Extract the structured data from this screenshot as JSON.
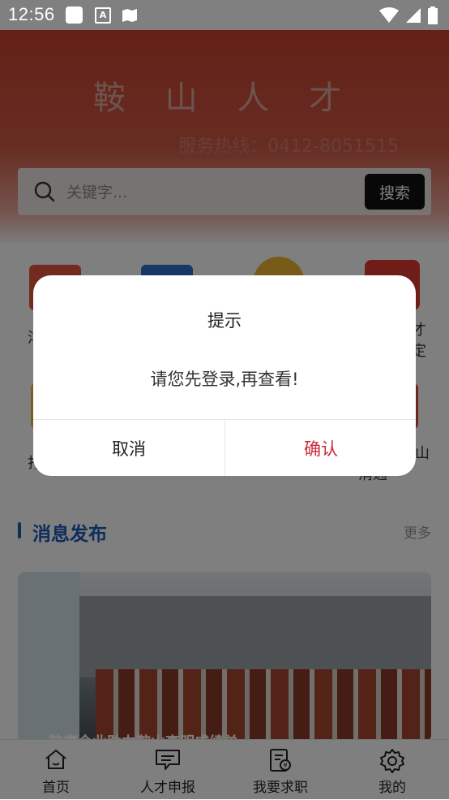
{
  "status_bar": {
    "time": "12:56",
    "icons": [
      "notification-square-icon",
      "a-badge-icon",
      "map-icon",
      "wifi-icon",
      "signal-icon",
      "battery-icon"
    ]
  },
  "header": {
    "app_title": "鞍 山 人 才",
    "hotline": "服务热线：0412-8051515",
    "search": {
      "placeholder": "关键字...",
      "button_label": "搜索"
    }
  },
  "grid": {
    "partial_labels": [
      "洋",
      "才",
      "定",
      "打",
      "山",
      "消通"
    ]
  },
  "news": {
    "section_title": "消息发布",
    "more_label": "更多",
    "card_caption": "鞍鹰企业助力鞍山高明成绩单"
  },
  "bottom_nav": {
    "items": [
      {
        "label": "首页",
        "icon": "home-icon"
      },
      {
        "label": "人才申报",
        "icon": "message-icon"
      },
      {
        "label": "我要求职",
        "icon": "document-icon"
      },
      {
        "label": "我的",
        "icon": "settings-icon"
      }
    ]
  },
  "dialog": {
    "title": "提示",
    "message": "请您先登录,再查看!",
    "cancel_label": "取消",
    "confirm_label": "确认"
  },
  "colors": {
    "header_red": "#c8412f",
    "accent_blue": "#1d5bb8",
    "confirm_red": "#d0283a"
  }
}
